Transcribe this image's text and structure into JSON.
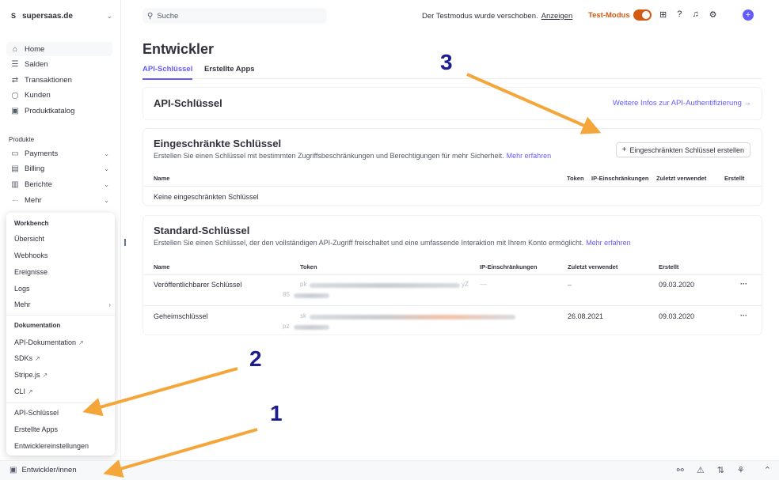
{
  "account": {
    "badge": "S",
    "name": "supersaas.de"
  },
  "nav": {
    "main": [
      {
        "label": "Home",
        "icon": "home-icon",
        "glyph": "⌂"
      },
      {
        "label": "Salden",
        "icon": "balances-icon",
        "glyph": "☰"
      },
      {
        "label": "Transaktionen",
        "icon": "transactions-icon",
        "glyph": "⇄"
      },
      {
        "label": "Kunden",
        "icon": "customers-icon",
        "glyph": "👤"
      },
      {
        "label": "Produktkatalog",
        "icon": "catalog-icon",
        "glyph": "▣"
      }
    ],
    "section_label": "Produkte",
    "products": [
      {
        "label": "Payments",
        "icon": "payments-icon",
        "glyph": "▭"
      },
      {
        "label": "Billing",
        "icon": "billing-icon",
        "glyph": "▤"
      },
      {
        "label": "Berichte",
        "icon": "reports-icon",
        "glyph": "▥"
      },
      {
        "label": "Mehr",
        "icon": "more-icon",
        "glyph": "···"
      }
    ]
  },
  "popover": {
    "workbench_heading": "Workbench",
    "workbench": [
      "Übersicht",
      "Webhooks",
      "Ereignisse",
      "Logs",
      "Mehr"
    ],
    "docs_heading": "Dokumentation",
    "docs": [
      "API-Dokumentation",
      "SDKs",
      "Stripe.js",
      "CLI"
    ],
    "dev": [
      "API-Schlüssel",
      "Erstellte Apps",
      "Entwicklereinstellungen"
    ]
  },
  "footer": {
    "label": "Entwickler/innen"
  },
  "topbar": {
    "search_placeholder": "Suche",
    "notice": "Der Testmodus wurde verschoben.",
    "notice_link": "Anzeigen",
    "test_mode": "Test-Modus"
  },
  "page": {
    "title": "Entwickler",
    "tabs": [
      "API-Schlüssel",
      "Erstellte Apps"
    ]
  },
  "api_card": {
    "title": "API-Schlüssel",
    "link": "Weitere Infos zur API-Authentifizierung →"
  },
  "restricted": {
    "title": "Eingeschränkte Schlüssel",
    "desc": "Erstellen Sie einen Schlüssel mit bestimmten Zugriffsbeschränkungen und Berechtigungen für mehr Sicherheit.",
    "more": "Mehr erfahren",
    "create_button": "Eingeschränkten Schlüssel erstellen",
    "columns": [
      "Name",
      "Token",
      "IP-Einschränkungen",
      "Zuletzt verwendet",
      "Erstellt"
    ],
    "empty": "Keine eingeschränkten Schlüssel"
  },
  "standard": {
    "title": "Standard-Schlüssel",
    "desc": "Erstellen Sie einen Schlüssel, der den vollständigen API-Zugriff freischaltet und eine umfassende Interaktion mit Ihrem Konto ermöglicht.",
    "more": "Mehr erfahren",
    "columns": [
      "Name",
      "Token",
      "IP-Einschränkungen",
      "Zuletzt verwendet",
      "Erstellt"
    ],
    "rows": [
      {
        "name": "Veröffentlichbarer Schlüssel",
        "token_prefix": "pk",
        "token_suffix": "yZ",
        "token_line2": "85",
        "ip": "—",
        "last_used": "–",
        "created": "09.03.2020",
        "menu": "···"
      },
      {
        "name": "Geheimschlüssel",
        "token_prefix": "sk",
        "token_suffix": "",
        "token_line2": "pz",
        "ip": "",
        "last_used": "26.08.2021",
        "created": "09.03.2020",
        "menu": "···"
      }
    ]
  },
  "annotations": {
    "m1": "1",
    "m2": "2",
    "m3": "3"
  },
  "colors": {
    "accent": "#635bff",
    "test_mode": "#d45a12",
    "arrow": "#f4a63a",
    "marker": "#1d1d8f"
  }
}
